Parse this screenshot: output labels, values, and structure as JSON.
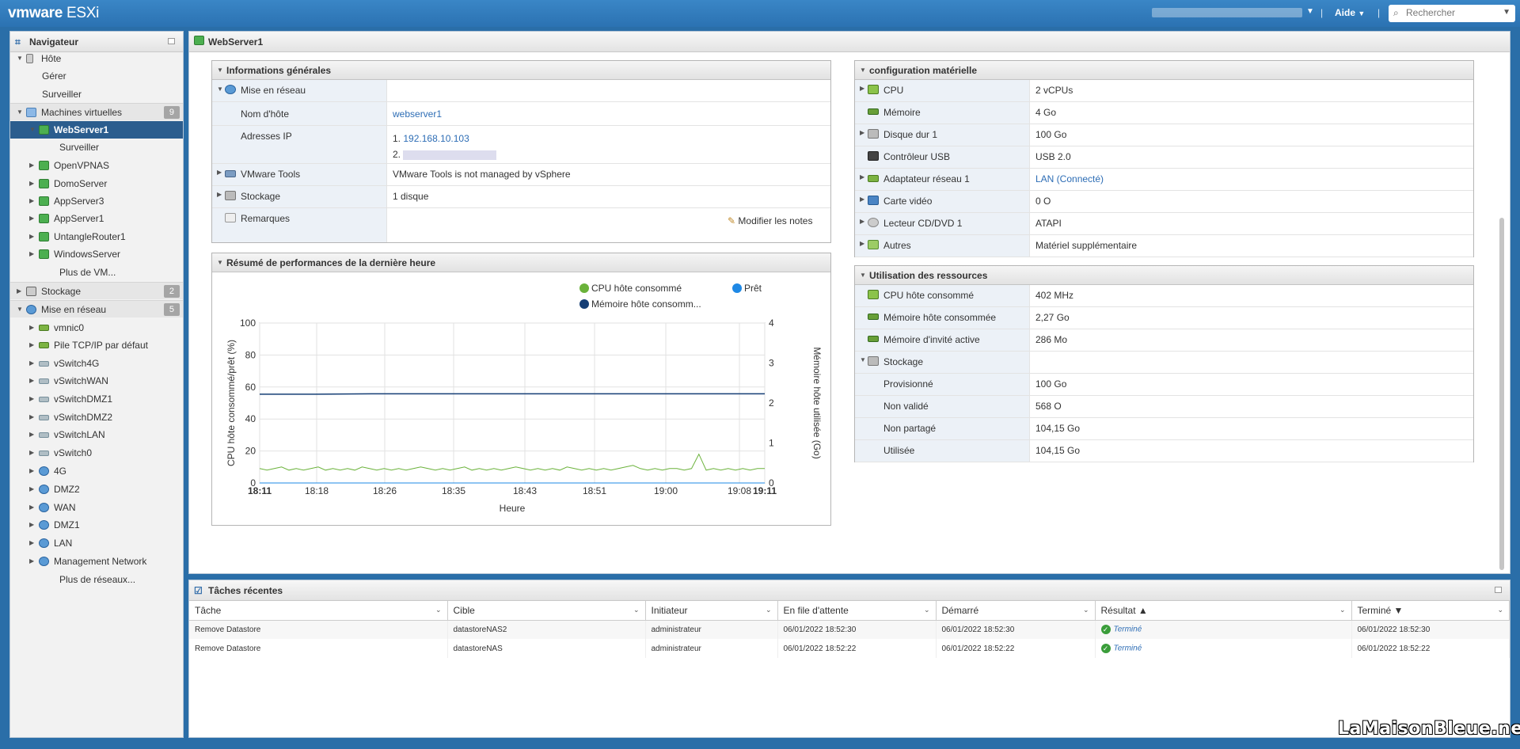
{
  "header": {
    "logo_vm": "vmware",
    "logo_product": "ESXi",
    "help": "Aide",
    "search_placeholder": "Rechercher"
  },
  "navigator": {
    "title": "Navigateur",
    "items": [
      {
        "label": "Hôte",
        "level": 0,
        "tw": "▼",
        "icon": "host-icon"
      },
      {
        "label": "Gérer",
        "level": 1
      },
      {
        "label": "Surveiller",
        "level": 1
      },
      {
        "label": "Machines virtuelles",
        "level": 0,
        "tw": "▼",
        "icon": "vms-icon",
        "count": "9",
        "sep": true
      },
      {
        "label": "WebServer1",
        "level": 2,
        "tw": "▼",
        "icon": "vm-icon",
        "selected": true
      },
      {
        "label": "Surveiller",
        "level": 3
      },
      {
        "label": "OpenVPNAS",
        "level": 2,
        "tw": "▶",
        "icon": "vm-icon"
      },
      {
        "label": "DomoServer",
        "level": 2,
        "tw": "▶",
        "icon": "vm-icon"
      },
      {
        "label": "AppServer3",
        "level": 2,
        "tw": "▶",
        "icon": "vm-icon"
      },
      {
        "label": "AppServer1",
        "level": 2,
        "tw": "▶",
        "icon": "vm-icon"
      },
      {
        "label": "UntangleRouter1",
        "level": 2,
        "tw": "▶",
        "icon": "vm-icon"
      },
      {
        "label": "WindowsServer",
        "level": 2,
        "tw": "▶",
        "icon": "vm-icon"
      },
      {
        "label": "Plus de VM...",
        "level": 3
      },
      {
        "label": "Stockage",
        "level": 0,
        "tw": "▶",
        "icon": "storage-icon",
        "count": "2",
        "sep": true
      },
      {
        "label": "Mise en réseau",
        "level": 0,
        "tw": "▼",
        "icon": "network-icon",
        "count": "5",
        "sep": true
      },
      {
        "label": "vmnic0",
        "level": 2,
        "tw": "▶",
        "icon": "nic-icon"
      },
      {
        "label": "Pile TCP/IP par défaut",
        "level": 2,
        "tw": "▶",
        "icon": "stack-icon"
      },
      {
        "label": "vSwitch4G",
        "level": 2,
        "tw": "▶",
        "icon": "switch-icon"
      },
      {
        "label": "vSwitchWAN",
        "level": 2,
        "tw": "▶",
        "icon": "switch-icon"
      },
      {
        "label": "vSwitchDMZ1",
        "level": 2,
        "tw": "▶",
        "icon": "switch-icon"
      },
      {
        "label": "vSwitchDMZ2",
        "level": 2,
        "tw": "▶",
        "icon": "switch-icon"
      },
      {
        "label": "vSwitchLAN",
        "level": 2,
        "tw": "▶",
        "icon": "switch-icon"
      },
      {
        "label": "vSwitch0",
        "level": 2,
        "tw": "▶",
        "icon": "switch-icon"
      },
      {
        "label": "4G",
        "level": 2,
        "tw": "▶",
        "icon": "portgroup-icon"
      },
      {
        "label": "DMZ2",
        "level": 2,
        "tw": "▶",
        "icon": "portgroup-icon"
      },
      {
        "label": "WAN",
        "level": 2,
        "tw": "▶",
        "icon": "portgroup-icon"
      },
      {
        "label": "DMZ1",
        "level": 2,
        "tw": "▶",
        "icon": "portgroup-icon"
      },
      {
        "label": "LAN",
        "level": 2,
        "tw": "▶",
        "icon": "portgroup-icon"
      },
      {
        "label": "Management Network",
        "level": 2,
        "tw": "▶",
        "icon": "portgroup-icon"
      },
      {
        "label": "Plus de réseaux...",
        "level": 3
      }
    ]
  },
  "main": {
    "title": "WebServer1",
    "general": {
      "title": "Informations générales",
      "network": "Mise en réseau",
      "hostname_label": "Nom d'hôte",
      "hostname": "webserver1",
      "ip_label": "Adresses IP",
      "ip1_prefix": "1.",
      "ip1": "192.168.10.103",
      "ip2_prefix": "2.",
      "tools_label": "VMware Tools",
      "tools_value": "VMware Tools is not managed by vSphere",
      "storage_label": "Stockage",
      "storage_value": "1 disque",
      "notes_label": "Remarques",
      "edit_notes": "Modifier les notes"
    },
    "hardware": {
      "title": "configuration matérielle",
      "rows": [
        {
          "label": "CPU",
          "value": "2 vCPUs",
          "tw": "▶",
          "icon": "cpu-icon"
        },
        {
          "label": "Mémoire",
          "value": "4 Go",
          "tw": "",
          "icon": "memory-icon"
        },
        {
          "label": "Disque dur 1",
          "value": "100 Go",
          "tw": "▶",
          "icon": "disk-icon"
        },
        {
          "label": "Contrôleur USB",
          "value": "USB 2.0",
          "tw": "",
          "icon": "usb-icon"
        },
        {
          "label": "Adaptateur réseau 1",
          "value": "LAN (Connecté)",
          "tw": "▶",
          "icon": "nic-icon",
          "link": true
        },
        {
          "label": "Carte vidéo",
          "value": "0 O",
          "tw": "▶",
          "icon": "video-icon"
        },
        {
          "label": "Lecteur CD/DVD 1",
          "value": "ATAPI",
          "tw": "▶",
          "icon": "cd-icon"
        },
        {
          "label": "Autres",
          "value": "Matériel supplémentaire",
          "tw": "▶",
          "icon": "other-icon"
        }
      ]
    },
    "resources": {
      "title": "Utilisation des ressources",
      "rows": [
        {
          "label": "CPU hôte consommé",
          "value": "402 MHz",
          "tw": "",
          "icon": "cpu-icon",
          "indent": false
        },
        {
          "label": "Mémoire hôte consommée",
          "value": "2,27 Go",
          "tw": "",
          "icon": "memory-icon",
          "indent": false
        },
        {
          "label": "Mémoire d'invité active",
          "value": "286 Mo",
          "tw": "",
          "icon": "memory-icon",
          "indent": false
        },
        {
          "label": "Stockage",
          "value": "",
          "tw": "▼",
          "icon": "storage-icon",
          "indent": false
        },
        {
          "label": "Provisionné",
          "value": "100 Go",
          "indent": true
        },
        {
          "label": "Non validé",
          "value": "568 O",
          "indent": true
        },
        {
          "label": "Non partagé",
          "value": "104,15 Go",
          "indent": true
        },
        {
          "label": "Utilisée",
          "value": "104,15 Go",
          "indent": true
        }
      ]
    },
    "perf_title": "Résumé de performances de la dernière heure"
  },
  "chart_data": {
    "type": "line",
    "x": [
      "18:11",
      "18:18",
      "18:26",
      "18:35",
      "18:43",
      "18:51",
      "19:00",
      "19:08",
      "19:11"
    ],
    "xlabel": "Heure",
    "ylabel": "CPU hôte consommé/prêt (%)",
    "y2label": "Mémoire hôte utilisée (Go)",
    "ylim": [
      0,
      100
    ],
    "y2lim": [
      0,
      4
    ],
    "yticks": [
      0,
      20,
      40,
      60,
      80,
      100
    ],
    "y2ticks": [
      0,
      1,
      2,
      3,
      4
    ],
    "legend": "top",
    "series": [
      {
        "name": "CPU hôte consommé",
        "color": "#6ab23a",
        "axis": "left",
        "values": [
          9,
          8,
          9,
          10,
          8,
          9,
          8,
          9,
          10,
          8,
          9,
          8,
          9,
          8,
          10,
          9,
          8,
          9,
          8,
          9,
          8,
          9,
          10,
          9,
          8,
          9,
          8,
          9,
          10,
          8,
          9,
          8,
          9,
          8,
          9,
          10,
          9,
          8,
          9,
          8,
          9,
          8,
          10,
          9,
          8,
          9,
          8,
          9,
          8,
          9,
          10,
          11,
          9,
          8,
          9,
          8,
          9,
          9,
          8,
          9,
          18,
          8,
          9,
          8,
          9,
          8,
          9,
          8,
          9,
          9
        ]
      },
      {
        "name": "Prêt",
        "color": "#1e88e5",
        "axis": "left",
        "values": [
          0,
          0,
          0,
          0,
          0,
          0,
          0,
          0,
          0,
          0
        ]
      },
      {
        "name": "Mémoire hôte consomm...",
        "color": "#153e75",
        "axis": "right",
        "values": [
          2.22,
          2.22,
          2.23,
          2.23,
          2.23,
          2.23,
          2.23,
          2.23,
          2.23,
          2.23
        ]
      }
    ]
  },
  "tasks": {
    "title": "Tâches récentes",
    "columns": [
      {
        "label": "Tâche",
        "sort": ""
      },
      {
        "label": "Cible",
        "sort": ""
      },
      {
        "label": "Initiateur",
        "sort": ""
      },
      {
        "label": "En file d'attente",
        "sort": ""
      },
      {
        "label": "Démarré",
        "sort": ""
      },
      {
        "label": "Résultat ▲",
        "sort": "asc"
      },
      {
        "label": "Terminé ▼",
        "sort": "desc"
      }
    ],
    "rows": [
      {
        "task": "Remove Datastore",
        "target": "datastoreNAS2",
        "initiator": "administrateur",
        "queued": "06/01/2022 18:52:30",
        "started": "06/01/2022 18:52:30",
        "result": "Terminé",
        "completed": "06/01/2022 18:52:30"
      },
      {
        "task": "Remove Datastore",
        "target": "datastoreNAS",
        "initiator": "administrateur",
        "queued": "06/01/2022 18:52:22",
        "started": "06/01/2022 18:52:22",
        "result": "Terminé",
        "completed": "06/01/2022 18:52:22"
      }
    ]
  },
  "watermark": "LaMaisonBleue.net"
}
